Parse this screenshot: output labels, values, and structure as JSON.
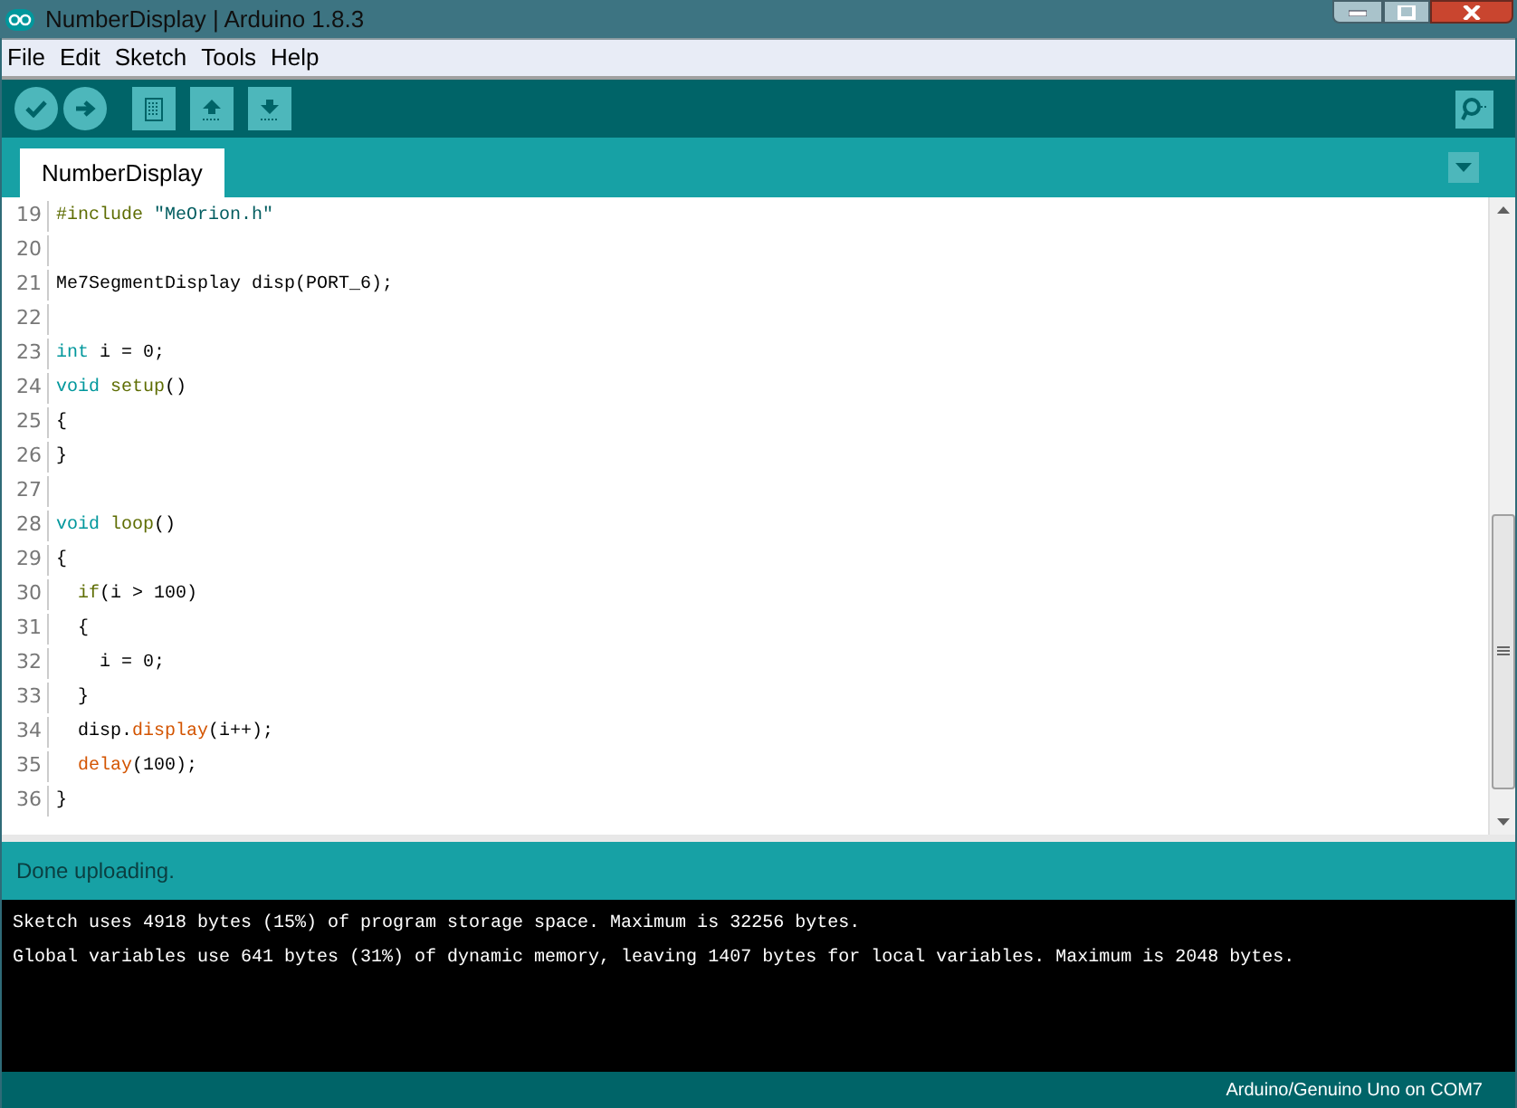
{
  "window": {
    "title": "NumberDisplay | Arduino 1.8.3"
  },
  "menu": [
    "File",
    "Edit",
    "Sketch",
    "Tools",
    "Help"
  ],
  "tabs": [
    {
      "label": "NumberDisplay",
      "selected": true
    }
  ],
  "editor": {
    "lines": [
      {
        "number": "19",
        "tokens": [
          {
            "kind": "pre",
            "text": "#include "
          },
          {
            "kind": "string",
            "text": "\"MeOrion.h\""
          }
        ]
      },
      {
        "number": "20"
      },
      {
        "number": "21",
        "tokens": [
          {
            "kind": "plain",
            "text": "Me7SegmentDisplay disp(PORT_6);"
          }
        ]
      },
      {
        "number": "22"
      },
      {
        "number": "23",
        "tokens": [
          {
            "kind": "keyword",
            "text": "int"
          },
          {
            "kind": "plain",
            "text": " i = 0;"
          }
        ]
      },
      {
        "number": "24",
        "tokens": [
          {
            "kind": "keyword",
            "text": "void "
          },
          {
            "kind": "function",
            "text": "setup"
          },
          {
            "kind": "plain",
            "text": "()"
          }
        ]
      },
      {
        "number": "25",
        "tokens": [
          {
            "kind": "plain",
            "text": "{"
          }
        ]
      },
      {
        "number": "26",
        "tokens": [
          {
            "kind": "plain",
            "text": "}"
          }
        ]
      },
      {
        "number": "27"
      },
      {
        "number": "28",
        "tokens": [
          {
            "kind": "keyword",
            "text": "void "
          },
          {
            "kind": "function",
            "text": "loop"
          },
          {
            "kind": "plain",
            "text": "()"
          }
        ]
      },
      {
        "number": "29",
        "tokens": [
          {
            "kind": "plain",
            "text": "{"
          }
        ]
      },
      {
        "number": "30",
        "tokens": [
          {
            "kind": "function",
            "text": "  if"
          },
          {
            "kind": "plain",
            "text": "(i > 100)"
          }
        ]
      },
      {
        "number": "31",
        "tokens": [
          {
            "kind": "plain",
            "text": "  {"
          }
        ]
      },
      {
        "number": "32",
        "tokens": [
          {
            "kind": "plain",
            "text": "    i = 0;"
          }
        ]
      },
      {
        "number": "33",
        "tokens": [
          {
            "kind": "plain",
            "text": "  }"
          }
        ]
      },
      {
        "number": "34",
        "tokens": [
          {
            "kind": "plain",
            "text": "  disp."
          },
          {
            "kind": "method",
            "text": "display"
          },
          {
            "kind": "plain",
            "text": "(i++);"
          }
        ]
      },
      {
        "number": "35",
        "tokens": [
          {
            "kind": "method",
            "text": "  delay"
          },
          {
            "kind": "plain",
            "text": "(100);"
          }
        ]
      },
      {
        "number": "36",
        "tokens": [
          {
            "kind": "plain",
            "text": "}"
          }
        ]
      }
    ]
  },
  "status": "Done uploading.",
  "console": [
    "Sketch uses 4918 bytes (15%) of program storage space. Maximum is 32256 bytes.",
    "Global variables use 641 bytes (31%) of dynamic memory, leaving 1407 bytes for local variables. Maximum is 2048 bytes."
  ],
  "footer": "Arduino/Genuino Uno on COM7"
}
